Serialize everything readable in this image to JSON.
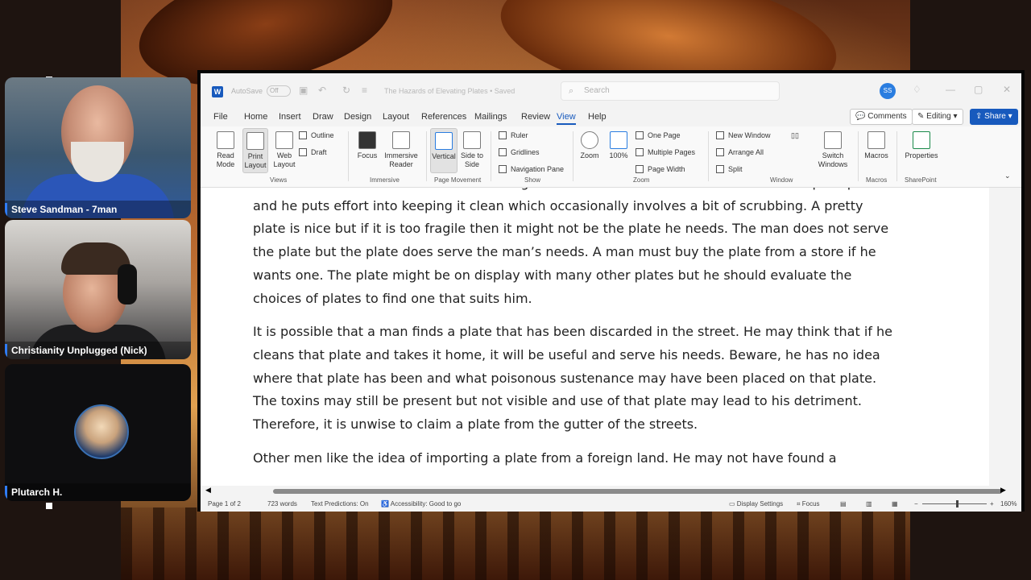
{
  "participants": [
    {
      "name": "Steve Sandman - 7man"
    },
    {
      "name": "Christianity Unplugged (Nick)"
    },
    {
      "name": "Plutarch H."
    }
  ],
  "word": {
    "app_logo": "W",
    "autosave_label": "AutoSave",
    "autosave_state": "Off",
    "doc_title": "The Hazards of Elevating Plates • Saved",
    "search_placeholder": "Search",
    "user_initials": "SS",
    "menu": [
      "File",
      "Home",
      "Insert",
      "Draw",
      "Design",
      "Layout",
      "References",
      "Mailings",
      "Review",
      "View",
      "Help"
    ],
    "active_menu": "View",
    "comments_label": "Comments",
    "editing_label": "Editing",
    "share_label": "Share",
    "ribbon": {
      "read_mode": "Read Mode",
      "print_layout": "Print Layout",
      "web_layout": "Web Layout",
      "outline": "Outline",
      "draft": "Draft",
      "views_group": "Views",
      "focus": "Focus",
      "immersive_reader": "Immersive Reader",
      "immersive_group": "Immersive",
      "vertical": "Vertical",
      "side_to_side": "Side to Side",
      "page_movement_group": "Page Movement",
      "ruler": "Ruler",
      "gridlines": "Gridlines",
      "navigation_pane": "Navigation Pane",
      "show_group": "Show",
      "zoom": "Zoom",
      "zoom_100": "100%",
      "one_page": "One Page",
      "multiple_pages": "Multiple Pages",
      "page_width": "Page Width",
      "zoom_group": "Zoom",
      "new_window": "New Window",
      "arrange_all": "Arrange All",
      "split": "Split",
      "switch_windows": "Switch Windows",
      "window_group": "Window",
      "macros": "Macros",
      "macros_group": "Macros",
      "properties": "Properties",
      "sharepoint_group": "SharePoint"
    },
    "paragraphs": [
      "he needs it to remain intact without taking his needs. He does not want to crack or chip his plate and he puts effort into keeping it clean which occasionally involves a bit of scrubbing. A pretty plate is nice but if it is too fragile then it might not be the plate he needs. The man does not serve the plate but the plate does serve the man’s needs. A man must buy the plate from a store if he wants one. The plate might be on display with many other plates but he should evaluate the choices of plates to find one that suits him.",
      "It is possible that a man finds a plate that has been discarded in the street. He may think that if he cleans that plate and takes it home, it will be useful and serve his needs. Beware, he has no idea where that plate has been and what poisonous sustenance may have been placed on that plate. The toxins may still be present but not visible and use of that plate may lead to his detriment. Therefore, it is unwise to claim a plate from the gutter of the streets.",
      "Other men like the idea of importing a plate from a foreign land. He may not have found a"
    ],
    "status": {
      "page": "Page 1 of 2",
      "words": "723 words",
      "text_predictions": "Text Predictions: On",
      "accessibility": "Accessibility: Good to go",
      "display_settings": "Display Settings",
      "focus": "Focus",
      "zoom_level": "160%"
    }
  }
}
